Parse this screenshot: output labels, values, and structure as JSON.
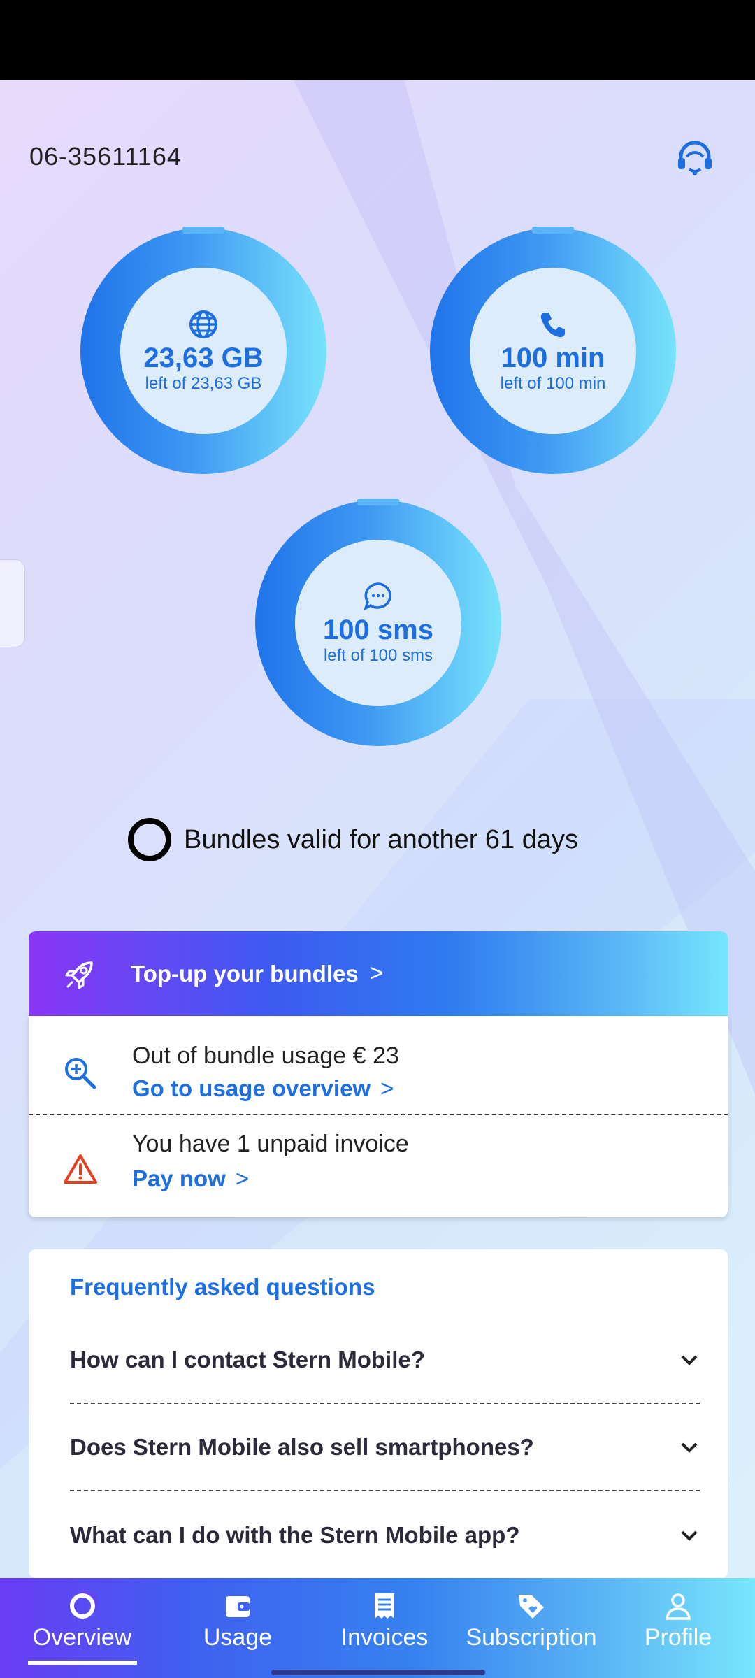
{
  "header": {
    "phone_number": "06-35611164",
    "support_icon": "headset-icon"
  },
  "bundles": {
    "data": {
      "value": "23,63 GB",
      "subtitle": "left of 23,63 GB",
      "icon": "globe-icon",
      "remaining_fraction": 1.0
    },
    "minutes": {
      "value": "100 min",
      "subtitle": "left of 100 min",
      "icon": "phone-icon",
      "remaining_fraction": 1.0
    },
    "sms": {
      "value": "100 sms",
      "subtitle": "left of 100 sms",
      "icon": "chat-icon",
      "remaining_fraction": 1.0
    }
  },
  "validity": {
    "text": "Bundles valid for another 61 days"
  },
  "topup": {
    "label": "Top-up your bundles",
    "chevron": ">",
    "icon": "rocket-icon"
  },
  "usage": {
    "out_of_bundle": "Out of bundle usage € 23",
    "usage_link": "Go to usage overview",
    "invoice_text": "You have 1 unpaid invoice",
    "pay_link": "Pay now",
    "chevron": ">"
  },
  "faq": {
    "title": "Frequently asked questions",
    "items": [
      {
        "question": "How can I contact Stern Mobile?"
      },
      {
        "question": "Does Stern Mobile also sell smartphones?"
      },
      {
        "question": "What can I do with the Stern Mobile app?"
      }
    ]
  },
  "nav": {
    "items": [
      {
        "label": "Overview",
        "icon": "overview-icon",
        "active": true
      },
      {
        "label": "Usage",
        "icon": "wallet-icon",
        "active": false
      },
      {
        "label": "Invoices",
        "icon": "invoice-icon",
        "active": false
      },
      {
        "label": "Subscription",
        "icon": "tag-icon",
        "active": false
      },
      {
        "label": "Profile",
        "icon": "user-icon",
        "active": false
      }
    ]
  },
  "colors": {
    "accent": "#1d6ee0",
    "warning": "#e04020",
    "ring_start": "#1f74ea",
    "ring_end": "#78e3fb"
  }
}
